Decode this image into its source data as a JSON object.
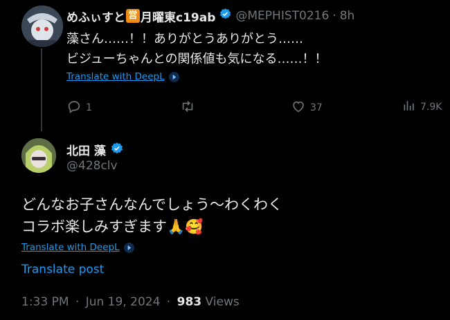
{
  "tweet1": {
    "display_name_a": "めふぃすと",
    "emoji_badge": "営",
    "display_name_b": "月曜東c19ab",
    "handle": "@MEPHIST0216",
    "separator": "·",
    "time": "8h",
    "body_line1": "藻さん……！！ありがとうありがとう……",
    "body_line2": "ビジューちゃんとの関係値も気になる……！！",
    "translate_label": "Translate with DeepL",
    "replies": "1",
    "retweets": "",
    "likes": "37",
    "views": "7.9K"
  },
  "tweet2": {
    "display_name": "北田 藻",
    "handle": "@428clv",
    "body_line1": "どんなお子さんなんでしょう～わくわく",
    "body_line2": "コラボ楽しみすぎます",
    "emoji1": "🙏",
    "emoji2": "🥰",
    "translate_deepl_label": "Translate with DeepL",
    "translate_post_label": "Translate post",
    "time": "1:33 PM",
    "separator": "·",
    "date": "Jun 19, 2024",
    "views_count": "983",
    "views_label": "Views"
  },
  "colors": {
    "background": "#000000",
    "text": "#e7e9ea",
    "muted": "#71767b",
    "link": "#1d9bf0",
    "verified": "#1d9bf0"
  }
}
